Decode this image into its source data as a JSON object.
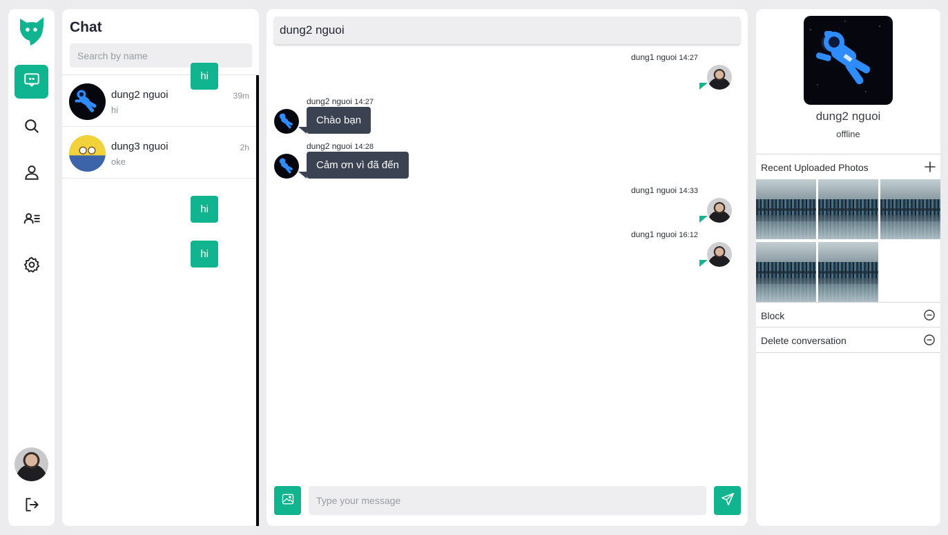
{
  "nav": {
    "logo_icon": "cat-logo-icon",
    "items": [
      {
        "icon": "chat-icon",
        "active": true
      },
      {
        "icon": "search-icon",
        "active": false
      },
      {
        "icon": "user-icon",
        "active": false
      },
      {
        "icon": "contacts-icon",
        "active": false
      },
      {
        "icon": "gear-icon",
        "active": false
      }
    ],
    "logout_icon": "logout-icon"
  },
  "chat_list": {
    "title": "Chat",
    "search_placeholder": "Search by name",
    "conversations": [
      {
        "name": "dung2 nguoi",
        "last_message": "hi",
        "time": "39m",
        "avatar": "astronaut"
      },
      {
        "name": "dung3 nguoi",
        "last_message": "oke",
        "time": "2h",
        "avatar": "minion"
      }
    ]
  },
  "chat": {
    "header_title": "dung2 nguoi",
    "messages": [
      {
        "sender": "dung1 nguoi",
        "time": "14:27",
        "text": "hi",
        "direction": "out"
      },
      {
        "sender": "dung2 nguoi",
        "time": "14:27",
        "text": "Chào bạn",
        "direction": "in"
      },
      {
        "sender": "dung2 nguoi",
        "time": "14:28",
        "text": "Cảm ơn vì đã đến",
        "direction": "in"
      },
      {
        "sender": "dung1 nguoi",
        "time": "14:33",
        "text": "hi",
        "direction": "out"
      },
      {
        "sender": "dung1 nguoi",
        "time": "16:12",
        "text": "hi",
        "direction": "out"
      }
    ],
    "composer_placeholder": "Type your message"
  },
  "profile": {
    "name": "dung2 nguoi",
    "status": "offline",
    "photos_label": "Recent Uploaded Photos",
    "photo_count": 5,
    "actions": [
      {
        "label": "Block",
        "icon": "minus-circle-icon"
      },
      {
        "label": "Delete conversation",
        "icon": "minus-circle-icon"
      }
    ]
  },
  "colors": {
    "accent": "#10b48f",
    "incoming_bubble": "#3b4252",
    "background": "#ececee"
  }
}
